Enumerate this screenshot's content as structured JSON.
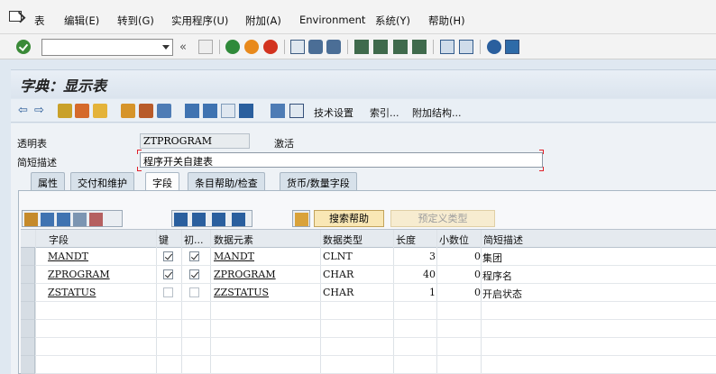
{
  "menu": [
    "表",
    "编辑(E)",
    "转到(G)",
    "实用程序(U)",
    "附加(A)",
    "Environment",
    "系统(Y)",
    "帮助(H)"
  ],
  "command_field": {
    "value": ""
  },
  "title": "字典：显示表",
  "app_toolbar": {
    "tech_settings": "技术设置",
    "indexes": "索引...",
    "append_structures": "附加结构..."
  },
  "header": {
    "table_label": "透明表",
    "table_name": "ZTPROGRAM",
    "status": "激活",
    "short_desc_label": "简短描述",
    "short_desc": "程序开关自建表"
  },
  "tabs": [
    "属性",
    "交付和维护",
    "字段",
    "条目帮助/检查",
    "货币/数量字段"
  ],
  "active_tab": "字段",
  "buttons": {
    "search_help": "搜索帮助",
    "predefined_type": "预定义类型"
  },
  "table": {
    "columns": [
      "字段",
      "键",
      "初...",
      "数据元素",
      "数据类型",
      "长度",
      "小数位",
      "简短描述"
    ],
    "rows": [
      {
        "field": "MANDT",
        "key": true,
        "init": true,
        "element": "MANDT",
        "type": "CLNT",
        "length": "3",
        "decimals": "0",
        "desc": "集团"
      },
      {
        "field": "ZPROGRAM",
        "key": true,
        "init": true,
        "element": "ZPROGRAM",
        "type": "CHAR",
        "length": "40",
        "decimals": "0",
        "desc": "程序名"
      },
      {
        "field": "ZSTATUS",
        "key": false,
        "init": false,
        "element": "ZZSTATUS",
        "type": "CHAR",
        "length": "1",
        "decimals": "0",
        "desc": "开启状态"
      }
    ]
  },
  "colors": {
    "background": "#dfe8f1",
    "search_button": "#f9e7b5",
    "required_marker": "#e0202a"
  }
}
